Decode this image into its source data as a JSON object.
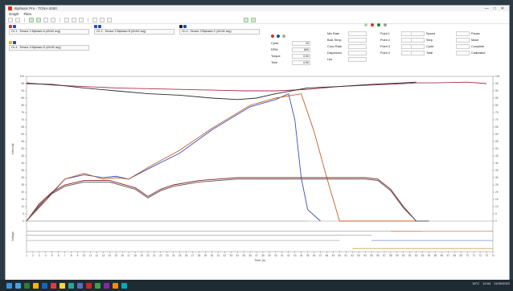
{
  "window": {
    "title": "Biphasic Pro - TCNA-2000",
    "controls": [
      "—",
      "□",
      "✕"
    ]
  },
  "menu": [
    "Graph",
    "Files"
  ],
  "toolbar": {
    "buttons": [
      "open",
      "save",
      "start",
      "stop",
      "pause",
      "marker",
      "zoom-in",
      "zoom-out",
      "pan",
      "print",
      "settings",
      "copy"
    ],
    "right_buttons": [
      "record",
      "export"
    ]
  },
  "channels": [
    {
      "label": "Ch 1 - Sensor 1 Biphasic A (dX/dX avg)",
      "colors": [
        "#c0392b",
        "#1f4fa6"
      ]
    },
    {
      "label": "Ch 2 - Sensor 2 Biphasic B (dX/dX avg)",
      "colors": [
        "#2a4bd1",
        "#1f4fa6"
      ]
    },
    {
      "label": "Ch 3 - Sensor 3 Biphasic C (dX/dX avg)",
      "colors": [
        "#1d1d1d",
        "#1f4fa6"
      ]
    },
    {
      "label": "Ch 4 - Sensor 4 Biphasic D (dX/dX avg)",
      "colors": [
        "#e3b21f",
        "#1f4fa6"
      ]
    }
  ],
  "status_leds": {
    "colors": [
      "#d6332b",
      "#1f4fa6",
      "#a9a9a9"
    ]
  },
  "params_left": [
    {
      "label": "Cycle",
      "value": "20"
    },
    {
      "label": "RPM",
      "value": "800"
    },
    {
      "label": "Torque",
      "value": "0.00"
    },
    {
      "label": "Time",
      "value": "0.00"
    }
  ],
  "params_mid": [
    {
      "label": "Mix Rate",
      "value": ""
    },
    {
      "label": "Bulk Temp",
      "value": ""
    },
    {
      "label": "Conc Rate",
      "value": ""
    },
    {
      "label": "Dispersion",
      "value": ""
    },
    {
      "label": "Lbs",
      "value": ""
    }
  ],
  "params_right": [
    {
      "label": "Point 1",
      "value": ""
    },
    {
      "label": "Point 2",
      "value": ""
    },
    {
      "label": "Point 3",
      "value": ""
    },
    {
      "label": "Point 4",
      "value": ""
    },
    {
      "label": "Speed",
      "value": ""
    },
    {
      "label": "Step",
      "value": ""
    },
    {
      "label": "Cycle",
      "value": ""
    },
    {
      "label": "Total",
      "value": ""
    }
  ],
  "params_far": [
    {
      "label": "Pause",
      "value": ""
    },
    {
      "label": "Mode",
      "value": ""
    },
    {
      "label": "Complete",
      "value": ""
    },
    {
      "label": "Calibrated",
      "value": ""
    }
  ],
  "indicators": {
    "colors": [
      "#a5d6a7",
      "#d6332b",
      "#2e7d32",
      "#9e9e9e"
    ]
  },
  "chart_data": {
    "type": "line",
    "ylabel": "Intensity",
    "y2label": "Voltage",
    "xlabel": "Time (s)",
    "x": [
      1,
      2,
      3,
      4,
      5,
      6,
      7,
      8,
      9,
      10,
      11,
      12,
      13,
      14,
      15,
      16,
      17,
      18,
      19,
      20,
      21,
      22,
      23,
      24,
      25,
      26,
      27,
      28,
      29,
      30,
      31,
      32,
      33,
      34,
      35,
      36,
      37,
      38,
      39,
      40,
      41,
      42,
      43,
      44,
      45,
      46,
      47,
      48,
      49,
      50,
      51,
      52,
      53,
      54,
      55,
      56,
      57,
      58,
      59,
      60,
      61,
      62,
      63,
      64,
      65,
      66,
      67,
      68,
      69,
      70,
      71,
      72,
      73,
      74
    ],
    "ylim": [
      0,
      100
    ],
    "yticks": [
      0,
      5,
      10,
      15,
      20,
      25,
      30,
      35,
      40,
      45,
      50,
      55,
      60,
      65,
      70,
      75,
      80,
      85,
      90,
      95,
      100
    ],
    "grid": false,
    "series": [
      {
        "color": "#a8324a",
        "x": [
          1,
          5,
          10,
          15,
          20,
          25,
          30,
          35,
          40,
          45,
          50,
          55,
          60,
          62,
          65,
          70,
          73
        ],
        "y": [
          95.5,
          94,
          93,
          92,
          91.5,
          91,
          90.5,
          90,
          90,
          91,
          93,
          94,
          95,
          95.5,
          95.5,
          96,
          95
        ]
      },
      {
        "color": "#2b2b2b",
        "x": [
          1,
          5,
          10,
          15,
          20,
          25,
          30,
          34,
          37,
          40,
          45,
          50,
          55,
          60,
          62
        ],
        "y": [
          95,
          94.5,
          92,
          90,
          88,
          87,
          85,
          84,
          85,
          88,
          92,
          93,
          94.5,
          95.5,
          96
        ]
      },
      {
        "color": "#3b4fbf",
        "x": [
          1,
          4,
          7,
          10,
          13,
          15,
          17,
          20,
          25,
          30,
          36,
          40,
          42,
          43,
          44,
          45,
          47
        ],
        "y": [
          0,
          15,
          29,
          32,
          30,
          31,
          29,
          36,
          47,
          63,
          79,
          84,
          88,
          70,
          30,
          8,
          0
        ]
      },
      {
        "color": "#c25f2a",
        "x": [
          1,
          4,
          7,
          10,
          13,
          15,
          17,
          20,
          25,
          30,
          36,
          40,
          44,
          46,
          48,
          50,
          53,
          60,
          62
        ],
        "y": [
          0,
          14,
          29,
          33,
          29,
          30,
          29,
          37,
          49,
          64,
          80,
          85,
          88,
          62,
          30,
          0,
          0,
          0,
          0
        ]
      },
      {
        "color": "#8b1f24",
        "x": [
          1,
          3,
          5,
          7,
          10,
          14,
          18,
          20,
          22,
          24,
          28,
          34,
          40,
          48,
          54,
          56,
          58,
          60,
          62,
          64
        ],
        "y": [
          0,
          12,
          20,
          25,
          28,
          28,
          23,
          17,
          22,
          25,
          28,
          30,
          30,
          30,
          30,
          29,
          22,
          10,
          0,
          0
        ]
      },
      {
        "color": "#555555",
        "x": [
          1,
          3,
          5,
          7,
          10,
          14,
          18,
          20,
          22,
          24,
          28,
          34,
          40,
          48,
          54,
          56,
          58,
          60,
          62,
          64
        ],
        "y": [
          0,
          11,
          19,
          24,
          27,
          27,
          22,
          16,
          21,
          24,
          27,
          29,
          29,
          29,
          29,
          28,
          21,
          9,
          0,
          0
        ]
      }
    ],
    "bottom_traces": [
      {
        "color": "#b0b0b0",
        "x": [
          1,
          45
        ],
        "y": [
          0,
          0
        ]
      },
      {
        "color": "#b0b0b0",
        "x": [
          1,
          63
        ],
        "y": [
          -10,
          -10
        ]
      },
      {
        "color": "#b0b0b0",
        "x": [
          1,
          55
        ],
        "y": [
          -14,
          -14
        ]
      },
      {
        "color": "#b0b0b0",
        "x": [
          1,
          50
        ],
        "y": [
          -19,
          -19
        ]
      },
      {
        "color": "#c9a44a",
        "x": [
          52,
          74
        ],
        "y": [
          -27,
          -27
        ]
      },
      {
        "color": "#7a92d6",
        "x": [
          55,
          74
        ],
        "y": [
          -19,
          -19
        ]
      },
      {
        "color": "#d88a7a",
        "x": [
          58,
          74
        ],
        "y": [
          -10,
          -10
        ]
      }
    ]
  },
  "taskbar": {
    "icons": [
      "#4aa3df",
      "#2e7d32",
      "#ffb300",
      "#1565c0",
      "#e53935",
      "#fdd835",
      "#26a69a",
      "#5c6bc0",
      "#c62828",
      "#43a047",
      "#8e24aa",
      "#fb8c00",
      "#00acc1"
    ],
    "tray": {
      "time": "10:04",
      "date": "11/30/2022",
      "temp": "16°C"
    }
  }
}
